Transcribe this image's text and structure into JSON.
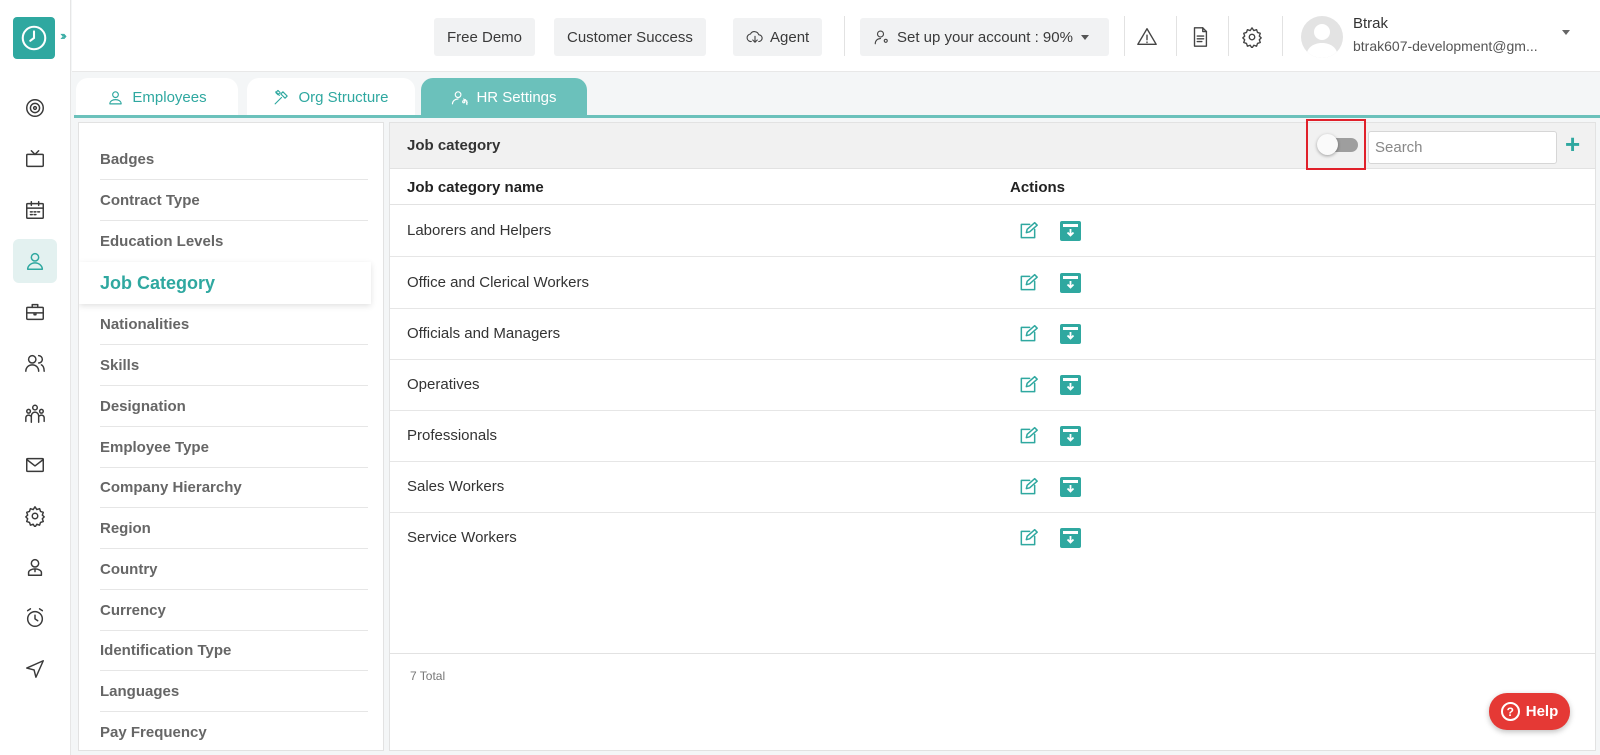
{
  "topbar": {
    "free_demo": "Free Demo",
    "customer_success": "Customer Success",
    "agent": "Agent",
    "setup": "Set up your account : 90%",
    "user_name": "Btrak",
    "user_email": "btrak607-development@gm..."
  },
  "tabs": [
    {
      "label": "Employees",
      "icon": "person-icon"
    },
    {
      "label": "Org Structure",
      "icon": "tools-icon"
    },
    {
      "label": "HR Settings",
      "icon": "user-settings-icon"
    }
  ],
  "menu": [
    "Badges",
    "Contract Type",
    "Education Levels",
    "Job Category",
    "Nationalities",
    "Skills",
    "Designation",
    "Employee Type",
    "Company Hierarchy",
    "Region",
    "Country",
    "Currency",
    "Identification Type",
    "Languages",
    "Pay Frequency"
  ],
  "menu_active": "Job Category",
  "panel": {
    "title": "Job category",
    "search_placeholder": "Search",
    "add": "+",
    "col_name": "Job category name",
    "col_actions": "Actions",
    "rows": [
      "Laborers and Helpers",
      "Office and Clerical Workers",
      "Officials and Managers",
      "Operatives",
      "Professionals",
      "Sales Workers",
      "Service Workers"
    ],
    "total": "7 Total"
  },
  "help": "Help",
  "colors": {
    "accent": "#2fa8a0",
    "highlight": "#e0202a",
    "help": "#e53935"
  }
}
